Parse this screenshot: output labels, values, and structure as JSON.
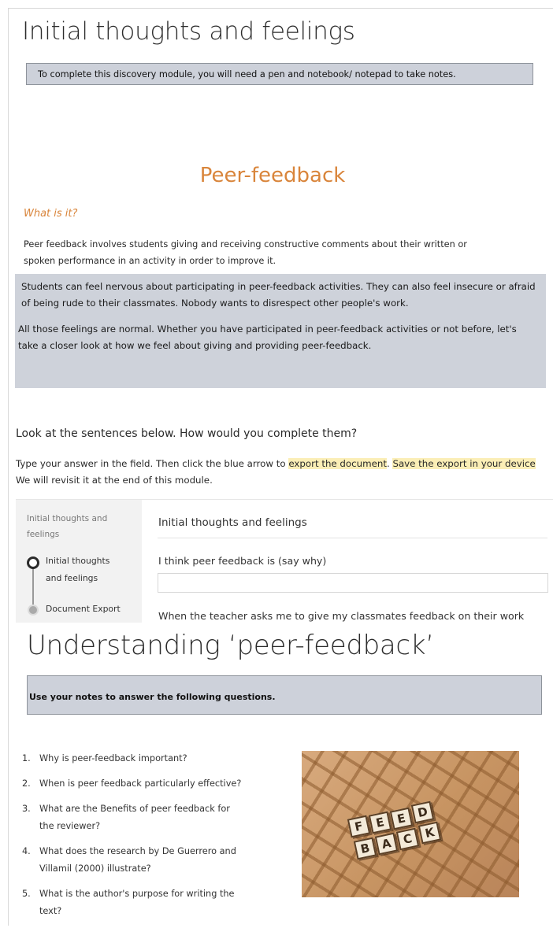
{
  "page_title": "Initial thoughts and feelings",
  "notice": "To complete this discovery module, you will need  a pen and notebook/ notepad to take notes.",
  "peer_feedback": {
    "title": "Peer-feedback",
    "what_label": "What is it?",
    "definition_line1": "Peer feedback involves students giving and receiving constructive comments about their written or",
    "definition_line2": "spoken  performance in an activity in order to improve it.",
    "feelings_p1": "Students can feel nervous about  participating in peer-feedback activities. They can also feel insecure or afraid of being rude to their classmates. Nobody wants to disrespect other people's work.",
    "feelings_p2": "All those feelings  are normal. Whether you have participated in peer-feedback activities or not before, let's take a closer look at how we feel about  giving and providing peer-feedback."
  },
  "instructions": {
    "lead": "Look at the sentences below. How would you complete them?",
    "part1": "Type your answer in the field.  Then click the blue arrow to ",
    "highlight1": "export the document",
    "part2": ". ",
    "highlight2": "Save the export in your device",
    "part3": " We will revisit it at the end of this module."
  },
  "widget": {
    "side_title_line1": "Initial thoughts and",
    "side_title_line2": "feelings",
    "steps": [
      {
        "label_line1": "Initial thoughts",
        "label_line2": "and feelings",
        "state": "current"
      },
      {
        "label_line1": "Document Export",
        "state": "pending"
      }
    ],
    "main_title": "Initial thoughts and feelings",
    "q1": "I think peer feedback is (say why)",
    "q1_value": "",
    "q2": "When the teacher asks me to give my classmates feedback on their work"
  },
  "understanding": {
    "title": "Understanding ‘peer-feedback’",
    "notice": "Use your notes to answer the following questions.",
    "questions": [
      {
        "n": "1.",
        "line1": "Why is peer-feedback important?"
      },
      {
        "n": "2.",
        "line1": "When is peer feedback particularly effective?"
      },
      {
        "n": "3.",
        "line1": "What are the Benefits of peer feedback for",
        "line2": "the reviewer?"
      },
      {
        "n": "4.",
        "line1": "What does the research by De Guerrero and",
        "line2": "Villamil (2000) illustrate?"
      },
      {
        "n": "5.",
        "line1": "What is the author's purpose for writing the",
        "line2": "text?"
      }
    ],
    "image_tiles": [
      "F",
      "E",
      "E",
      "D",
      "B",
      "A",
      "C",
      "K"
    ]
  }
}
